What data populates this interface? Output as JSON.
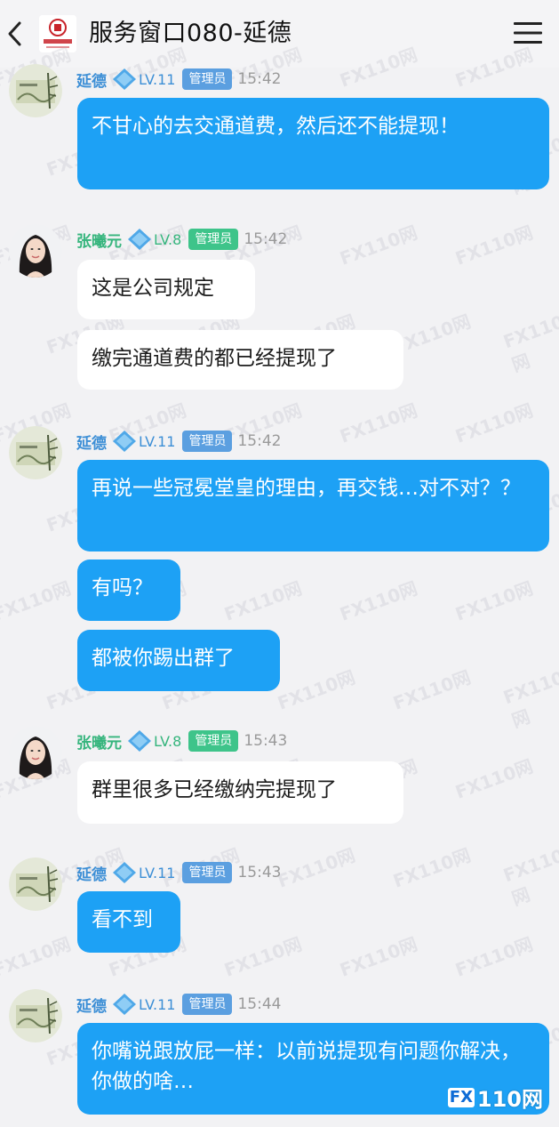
{
  "header": {
    "title": "服务窗口080-延德",
    "back_icon": "chevron-left-icon",
    "menu_icon": "hamburger-menu-icon",
    "logo_text": "中泰证券"
  },
  "users": {
    "yande": {
      "name": "延德",
      "level": "LV.11",
      "role": "管理员"
    },
    "zhangxiyuan": {
      "name": "张曦元",
      "level": "LV.8",
      "role": "管理员"
    }
  },
  "messages": [
    {
      "sender": "yande",
      "time": "15:42",
      "bubbles": [
        "不甘心的去交通道费，然后还不能提现！"
      ]
    },
    {
      "sender": "zhangxiyuan",
      "time": "15:42",
      "bubbles": [
        "这是公司规定",
        "缴完通道费的都已经提现了"
      ]
    },
    {
      "sender": "yande",
      "time": "15:42",
      "bubbles": [
        "再说一些冠冕堂皇的理由，再交钱…对不对？？",
        "有吗？",
        "都被你踢出群了"
      ]
    },
    {
      "sender": "zhangxiyuan",
      "time": "15:43",
      "bubbles": [
        "群里很多已经缴纳完提现了"
      ]
    },
    {
      "sender": "yande",
      "time": "15:43",
      "bubbles": [
        "看不到"
      ]
    },
    {
      "sender": "yande",
      "time": "15:44",
      "bubbles": [
        "你嘴说跟放屁一样：以前说提现有问题你解决，你做的啥…"
      ]
    }
  ],
  "watermark": {
    "text": "FX110网",
    "brand": "110网",
    "brand_mark": "FX"
  },
  "colors": {
    "sent_bubble": "#1da1f5",
    "received_bubble": "#ffffff",
    "yande_accent": "#3d8fd6",
    "zxy_accent": "#36b57d"
  }
}
